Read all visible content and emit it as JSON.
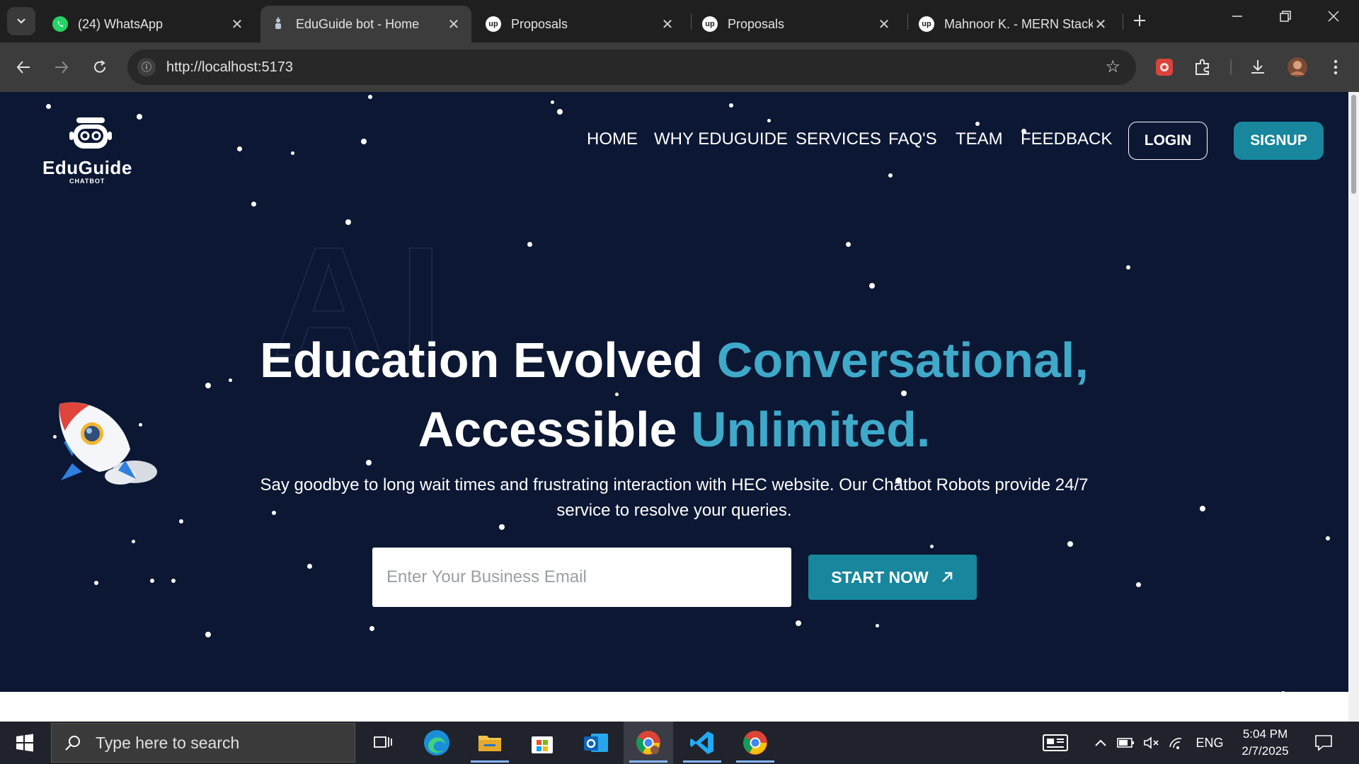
{
  "browser": {
    "tabs": [
      {
        "title": "(24) WhatsApp",
        "favicon": "whatsapp-icon",
        "active": false
      },
      {
        "title": "EduGuide bot - Home",
        "favicon": "eduguide-icon",
        "active": true
      },
      {
        "title": "Proposals",
        "favicon": "upwork-icon",
        "active": false
      },
      {
        "title": "Proposals",
        "favicon": "upwork-icon",
        "active": false
      },
      {
        "title": "Mahnoor K. - MERN Stack",
        "favicon": "upwork-icon",
        "active": false
      }
    ],
    "url": "http://localhost:5173"
  },
  "page": {
    "logo": {
      "name": "EduGuide",
      "sub": "CHATBOT"
    },
    "nav": [
      "HOME",
      "WHY EDUGUIDE",
      "SERVICES",
      "FAQ'S",
      "TEAM",
      "FEEDBACK"
    ],
    "login_label": "LOGIN",
    "signup_label": "SIGNUP",
    "watermark": "AI",
    "headline": {
      "line1_white": "Education Evolved",
      "line1_accent": "Conversational,",
      "line2_white": "Accessible",
      "line2_accent": "Unlimited."
    },
    "subtext": "Say goodbye to long wait times and frustrating interaction with HEC website. Our Chatbot Robots provide 24/7 service to resolve your queries.",
    "email_placeholder": "Enter Your Business Email",
    "start_label": "START NOW",
    "colors": {
      "background": "#0b1733",
      "accent": "#3fa9c9",
      "button": "#18869d"
    }
  },
  "taskbar": {
    "search_placeholder": "Type here to search",
    "language": "ENG",
    "time": "5:04 PM",
    "date": "2/7/2025"
  }
}
